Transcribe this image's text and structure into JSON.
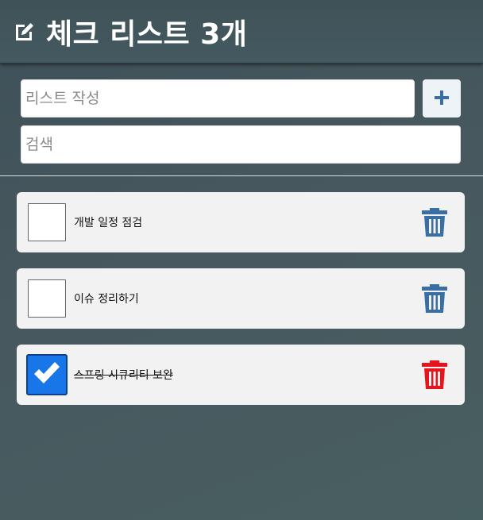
{
  "header": {
    "title": "체크 리스트 3개",
    "icon": "edit-icon"
  },
  "form": {
    "add_placeholder": "리스트 작성",
    "add_value": "",
    "add_button_icon": "plus-icon",
    "search_placeholder": "검색",
    "search_value": ""
  },
  "items": [
    {
      "label": "개발 일정 점검",
      "checked": false,
      "trash_color": "#3a6fa3"
    },
    {
      "label": "이슈 정리하기",
      "checked": false,
      "trash_color": "#3a6fa3"
    },
    {
      "label": "스프링 시큐리티 보완",
      "checked": true,
      "trash_color": "#e8141c"
    }
  ],
  "colors": {
    "accent_blue": "#1976e8",
    "plus_blue": "#3a6fa3",
    "danger_red": "#e8141c"
  }
}
